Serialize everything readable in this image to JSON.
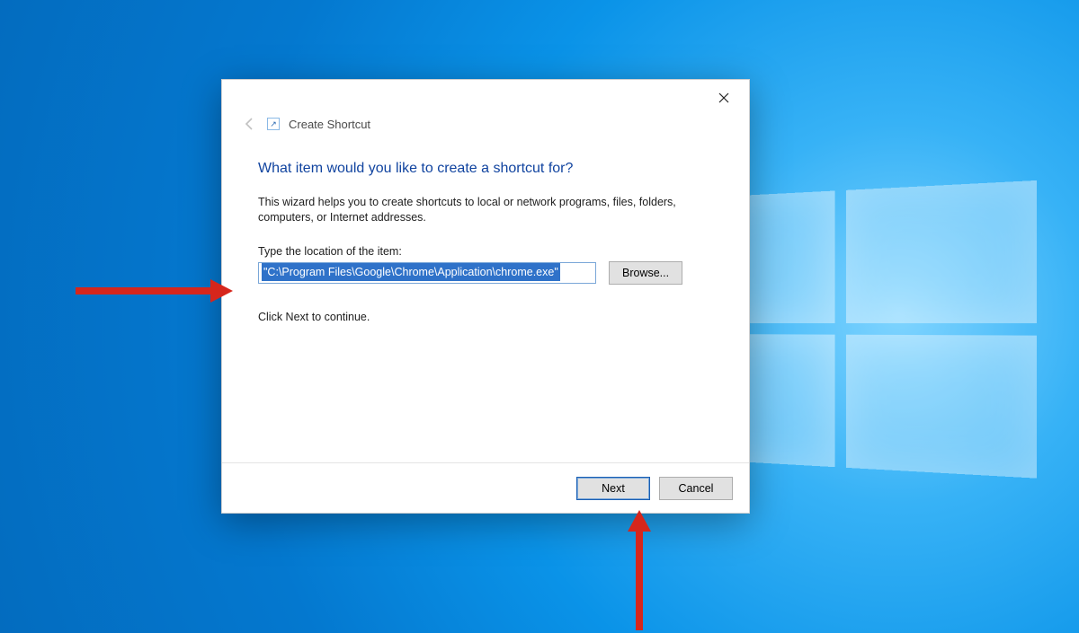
{
  "dialog": {
    "title": "Create Shortcut",
    "headline": "What item would you like to create a shortcut for?",
    "description": "This wizard helps you to create shortcuts to local or network programs, files, folders, computers, or Internet addresses.",
    "field_label": "Type the location of the item:",
    "location_value": "\"C:\\Program Files\\Google\\Chrome\\Application\\chrome.exe\"",
    "browse_label": "Browse...",
    "continue_hint": "Click Next to continue.",
    "next_label": "Next",
    "cancel_label": "Cancel"
  },
  "annotations": {
    "arrow_color": "#d6261c"
  }
}
